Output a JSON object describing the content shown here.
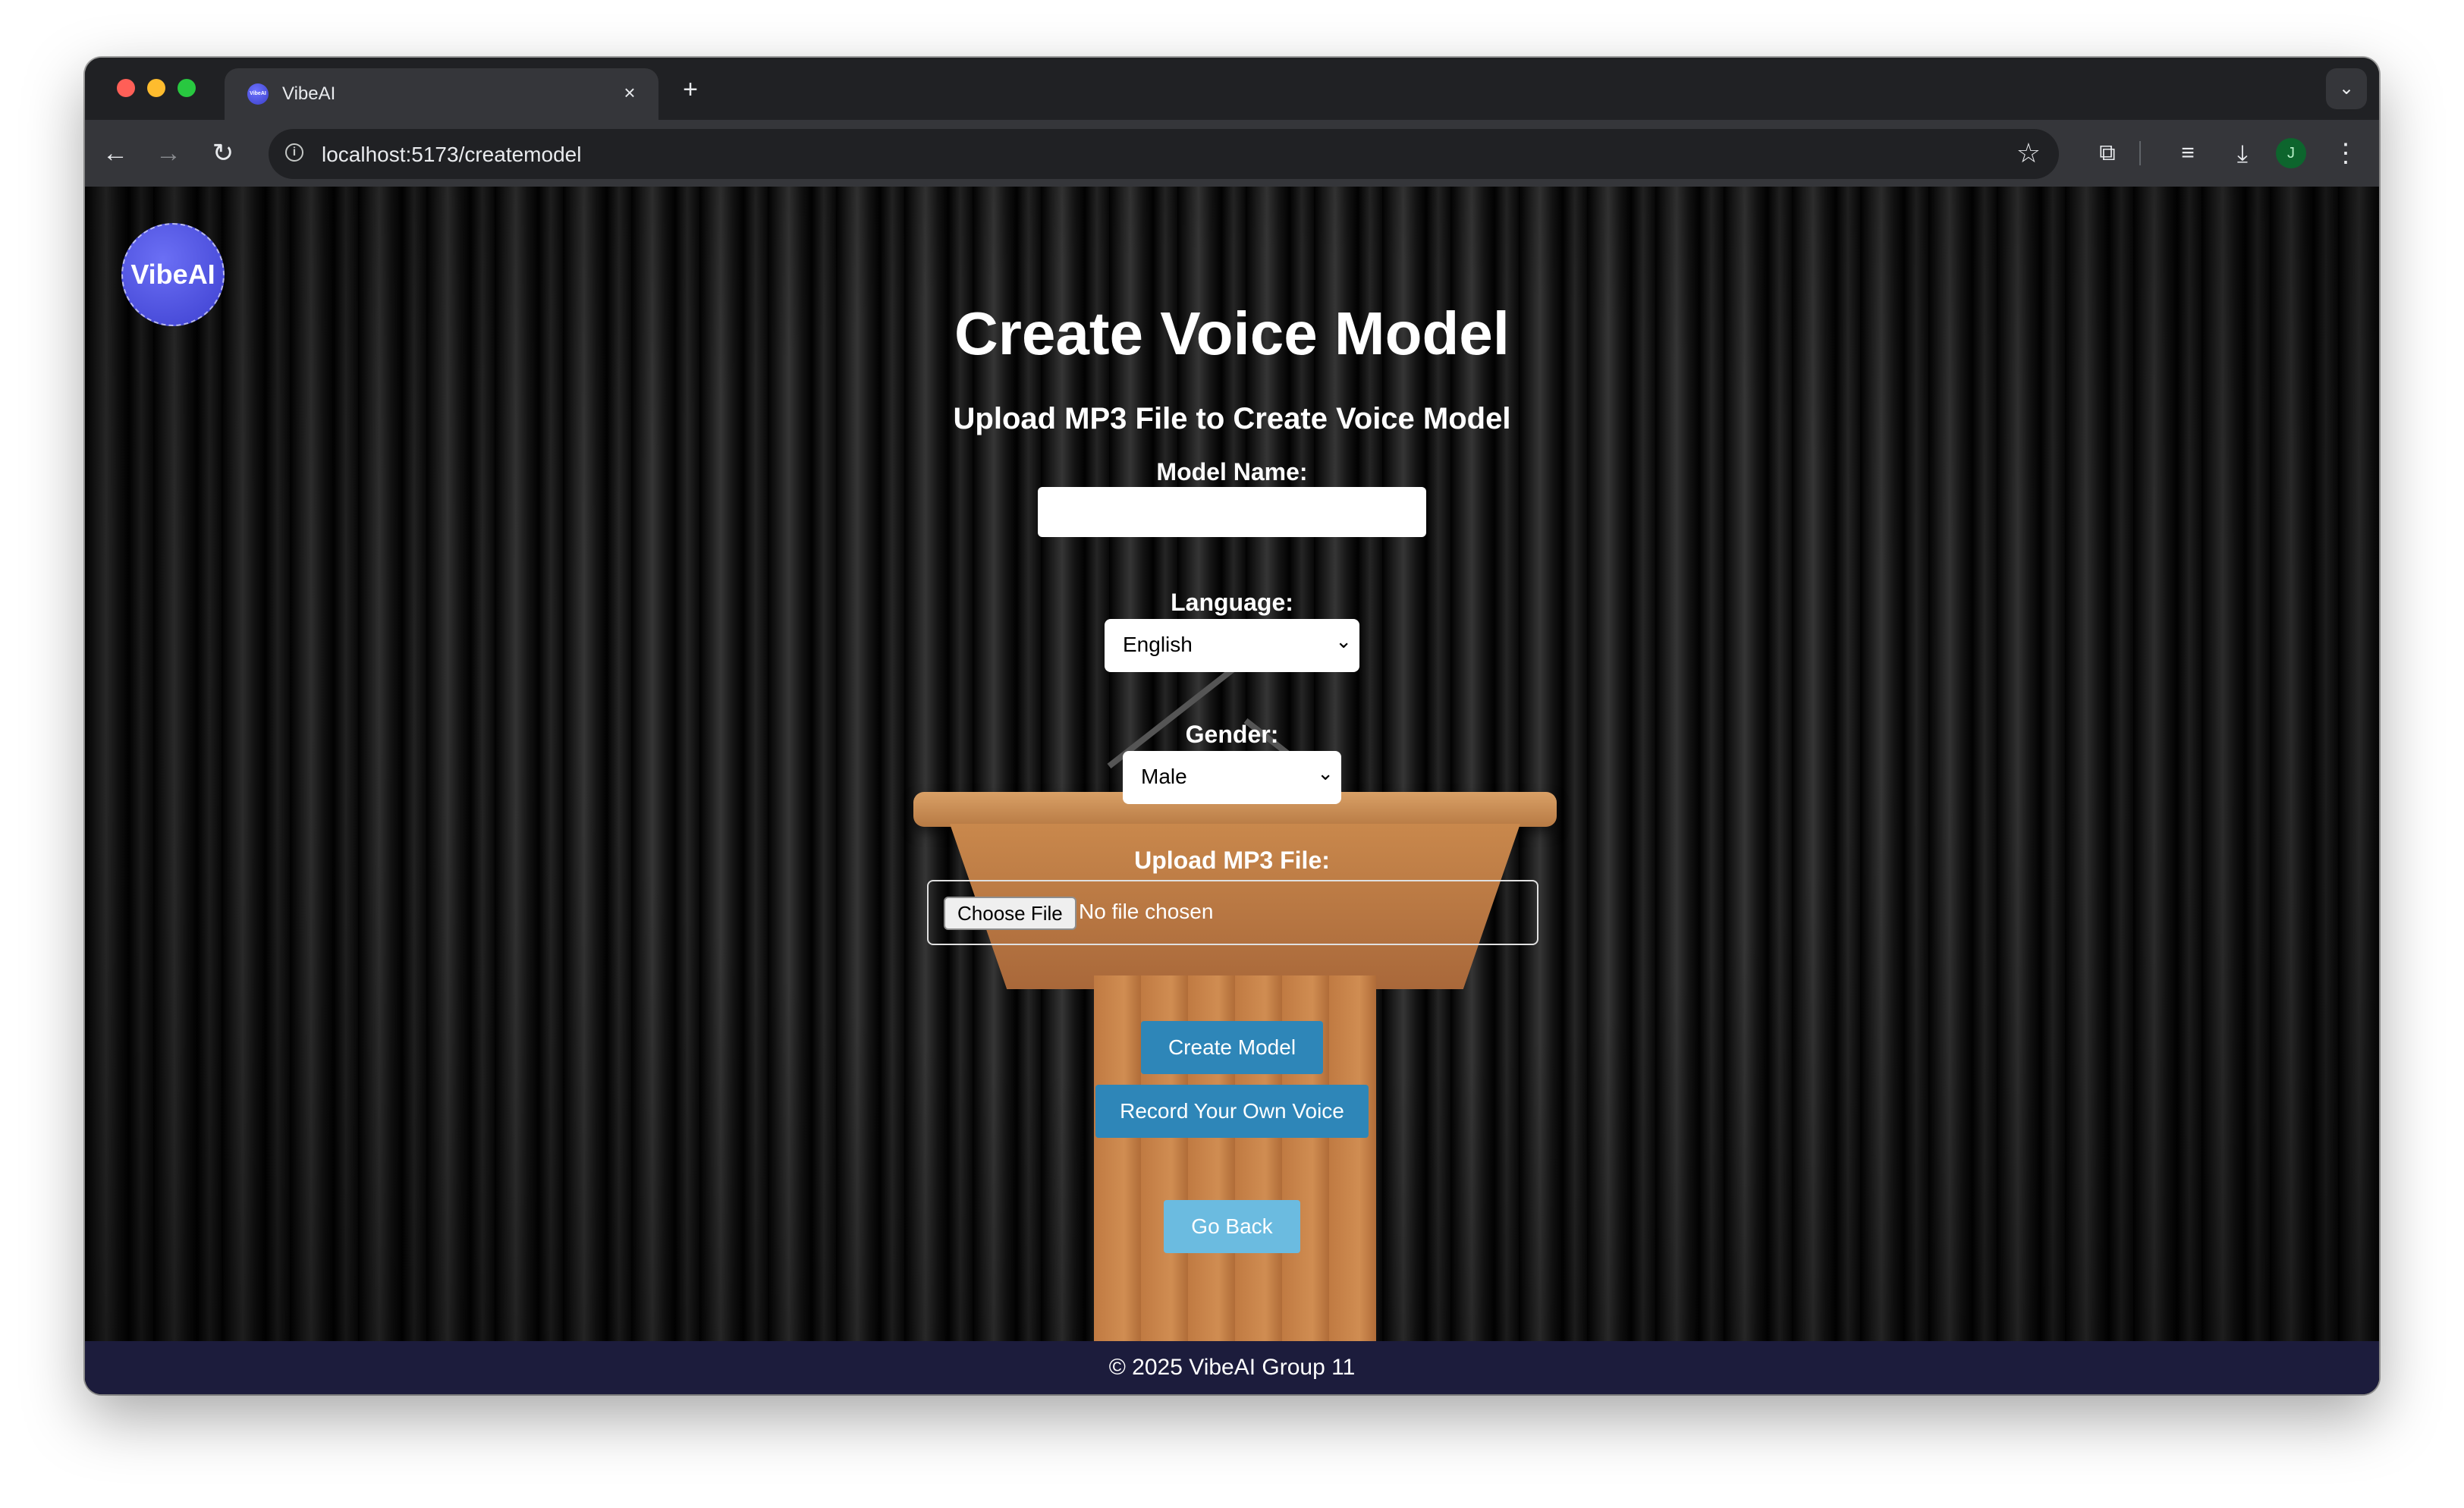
{
  "browser": {
    "tab_title": "VibeAI",
    "favicon_text": "VibeAI",
    "url": "localhost:5173/createmodel",
    "profile_initial": "J"
  },
  "page": {
    "logo_text": "VibeAI",
    "title": "Create Voice Model",
    "subtitle": "Upload MP3 File to Create Voice Model",
    "model_name": {
      "label": "Model Name:",
      "value": ""
    },
    "language": {
      "label": "Language:",
      "selected": "English"
    },
    "gender": {
      "label": "Gender:",
      "selected": "Male"
    },
    "upload": {
      "label": "Upload MP3 File:",
      "choose_button": "Choose File",
      "status": "No file chosen"
    },
    "buttons": {
      "create": "Create Model",
      "record": "Record Your Own Voice",
      "back": "Go Back"
    },
    "footer": "© 2025 VibeAI Group 11"
  },
  "colors": {
    "primary_button": "#2e86b8",
    "secondary_button": "#6bbbe0",
    "footer_bg": "#1c1c3c",
    "logo": "#4b4fe0"
  }
}
